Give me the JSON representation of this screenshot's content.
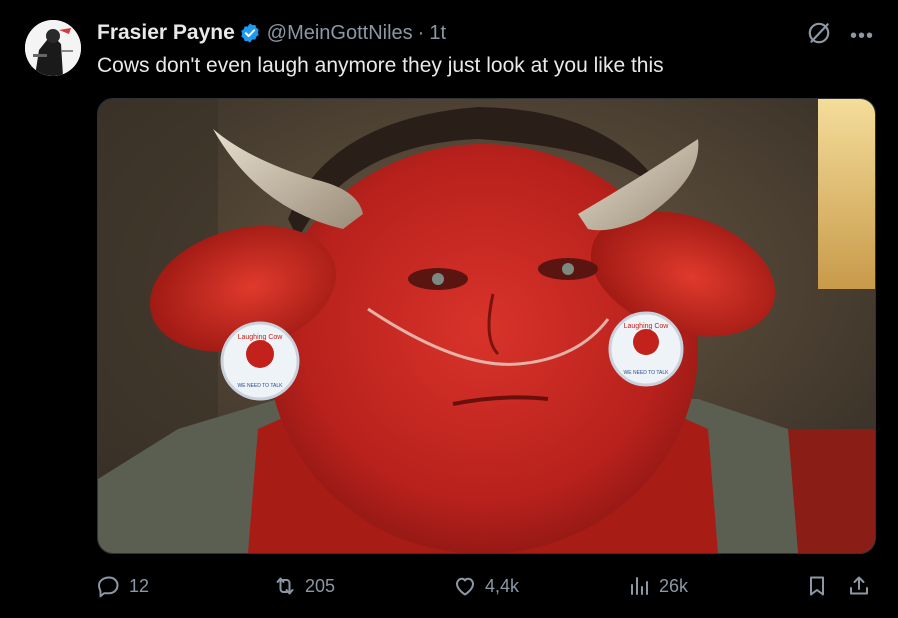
{
  "author": {
    "display_name": "Frasier Payne",
    "handle": "@MeinGottNiles",
    "separator": "·",
    "time": "1t",
    "verified": true
  },
  "tweet": {
    "text": "Cows don't even laugh anymore they just look at you like this"
  },
  "media": {
    "badge_text_left": "Laughing Cow",
    "badge_text_right": "Laughing Cow",
    "badge_subtext": "WE NEED TO TALK"
  },
  "actions": {
    "reply_count": "12",
    "repost_count": "205",
    "like_count": "4,4k",
    "view_count": "26k"
  },
  "colors": {
    "background": "#000000",
    "text_primary": "#e7e9ea",
    "text_secondary": "#8b98a5",
    "verified_blue": "#1d9bf0"
  },
  "icons": [
    "grok-icon",
    "more-icon",
    "verified-icon",
    "reply-icon",
    "repost-icon",
    "like-icon",
    "views-icon",
    "bookmark-icon",
    "share-icon"
  ]
}
